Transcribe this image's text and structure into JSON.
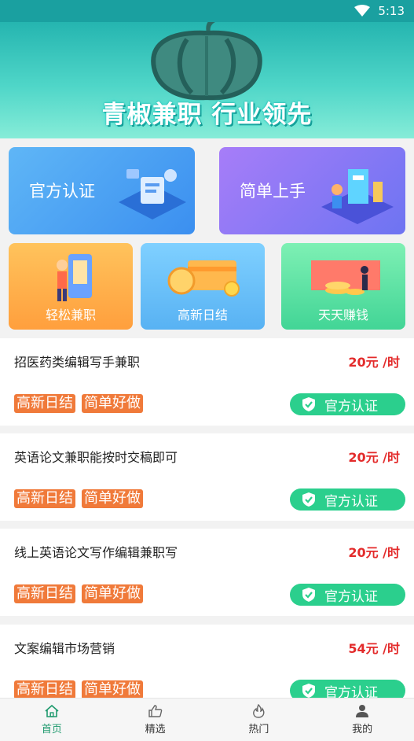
{
  "status_bar": {
    "time": "5:13"
  },
  "banner": {
    "slogan": "青椒兼职 行业领先"
  },
  "categories": [
    {
      "label": "官方认证"
    },
    {
      "label": "简单上手"
    },
    {
      "label": "轻松兼职"
    },
    {
      "label": "高新日结"
    },
    {
      "label": "天天赚钱"
    }
  ],
  "jobs": [
    {
      "title": "招医药类编辑写手兼职",
      "salary": "20元 /时",
      "tags": [
        "高新日结",
        "简单好做"
      ],
      "badge": "官方认证"
    },
    {
      "title": "英语论文兼职能按时交稿即可",
      "salary": "20元 /时",
      "tags": [
        "高新日结",
        "简单好做"
      ],
      "badge": "官方认证"
    },
    {
      "title": "线上英语论文写作编辑兼职写",
      "salary": "20元 /时",
      "tags": [
        "高新日结",
        "简单好做"
      ],
      "badge": "官方认证"
    },
    {
      "title": "文案编辑市场营销",
      "salary": "54元 /时",
      "tags": [
        "高新日结",
        "简单好做"
      ],
      "badge": "官方认证"
    }
  ],
  "tabbar": [
    {
      "label": "首页",
      "icon": "home-icon"
    },
    {
      "label": "精选",
      "icon": "thumbs-up-icon"
    },
    {
      "label": "热门",
      "icon": "flame-icon"
    },
    {
      "label": "我的",
      "icon": "person-icon"
    }
  ],
  "colors": {
    "accent": "#1f9a6e",
    "salary": "#e32b2b",
    "tag": "#f07a3a",
    "badge": "#2bcf8d"
  }
}
